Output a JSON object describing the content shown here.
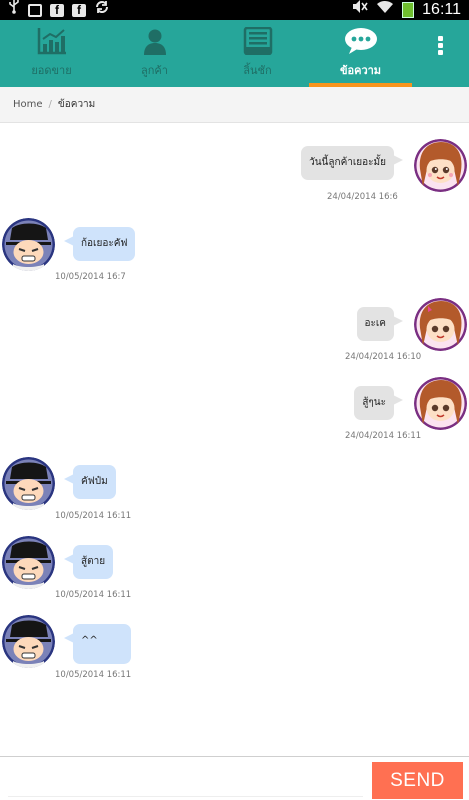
{
  "status_bar": {
    "time": "16:11",
    "icons": [
      "usb-icon",
      "image-icon",
      "facebook-icon",
      "facebook-icon",
      "sync-icon",
      "mute-icon",
      "wifi-icon",
      "battery-icon"
    ]
  },
  "tabs": [
    {
      "label": "ยอดขาย",
      "icon": "chart-icon",
      "active": false
    },
    {
      "label": "ลูกค้า",
      "icon": "person-icon",
      "active": false
    },
    {
      "label": "ลิ้นชัก",
      "icon": "drawer-icon",
      "active": false
    },
    {
      "label": "ข้อความ",
      "icon": "chat-icon",
      "active": true
    }
  ],
  "breadcrumb": {
    "home": "Home",
    "current": "ข้อความ"
  },
  "messages": [
    {
      "side": "right",
      "text": "วันนี้ลูกค้าเยอะมั้ย",
      "time": "24/04/2014 16:6",
      "avatar": "girl-avatar"
    },
    {
      "side": "left",
      "text": "ก้อเยอะคัฟ",
      "time": "10/05/2014 16:7",
      "avatar": "boy-avatar"
    },
    {
      "side": "right",
      "text": "อะเค",
      "time": "24/04/2014 16:10",
      "avatar": "girl-avatar"
    },
    {
      "side": "right",
      "text": "สู้ๆนะ",
      "time": "24/04/2014 16:11",
      "avatar": "girl-avatar"
    },
    {
      "side": "left",
      "text": "คัฟป๋ม",
      "time": "10/05/2014 16:11",
      "avatar": "boy-avatar"
    },
    {
      "side": "left",
      "text": "สู้ตาย",
      "time": "10/05/2014 16:11",
      "avatar": "boy-avatar"
    },
    {
      "side": "left",
      "text": "^^",
      "time": "10/05/2014 16:11",
      "avatar": "boy-avatar"
    }
  ],
  "composer": {
    "value": "",
    "send_label": "SEND"
  },
  "colors": {
    "tab_bar": "#26a69a",
    "active_indicator": "#f7941d",
    "send_button": "#ff7052",
    "bubble_left": "#cfe3fb",
    "bubble_right": "#e3e3e3"
  }
}
